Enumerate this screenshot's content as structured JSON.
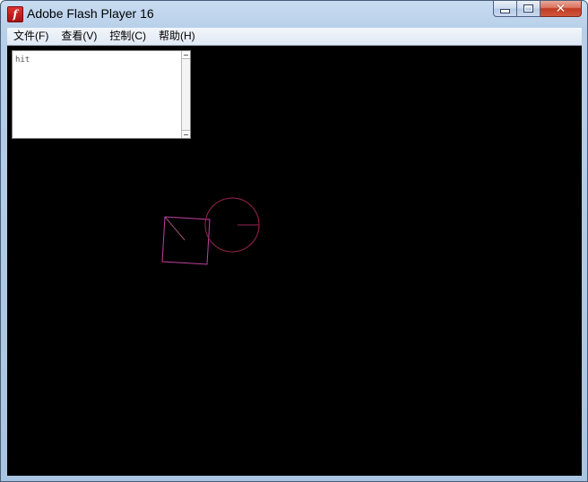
{
  "window": {
    "title": "Adobe Flash Player 16",
    "app_icon_glyph": "f",
    "close_glyph": "✕"
  },
  "menu": {
    "items": [
      "文件(F)",
      "查看(V)",
      "控制(C)",
      "帮助(H)"
    ]
  },
  "trace_output": {
    "text": "hit"
  },
  "colors": {
    "stage_background": "#000000",
    "square_stroke": "#c040a0",
    "circle_stroke": "#9a2452"
  }
}
